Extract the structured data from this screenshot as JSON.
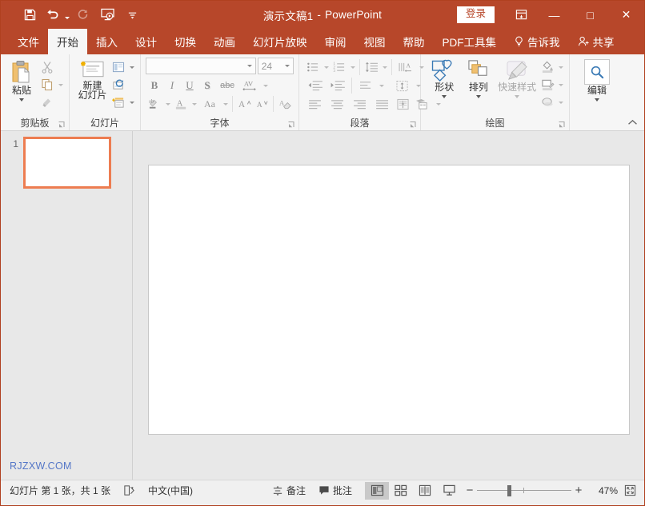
{
  "titlebar": {
    "quick_access": [
      {
        "name": "save-icon",
        "label": "保存"
      },
      {
        "name": "undo-icon",
        "label": "撤消"
      },
      {
        "name": "redo-icon",
        "label": "恢复"
      },
      {
        "name": "start-slideshow-icon",
        "label": "从头开始"
      },
      {
        "name": "customize-qat-icon",
        "label": "自定义快速访问工具栏"
      }
    ],
    "document_title": "演示文稿1",
    "separator": "-",
    "app_name": "PowerPoint",
    "signin_label": "登录",
    "ribbon_display_options": "ribbon-display-options-icon",
    "minimize": "—",
    "maximize": "□",
    "close": "✕",
    "accent_color": "#b7472a"
  },
  "tabs": [
    {
      "label": "文件",
      "active": false
    },
    {
      "label": "开始",
      "active": true
    },
    {
      "label": "插入",
      "active": false
    },
    {
      "label": "设计",
      "active": false
    },
    {
      "label": "切换",
      "active": false
    },
    {
      "label": "动画",
      "active": false
    },
    {
      "label": "幻灯片放映",
      "active": false
    },
    {
      "label": "审阅",
      "active": false
    },
    {
      "label": "视图",
      "active": false
    },
    {
      "label": "帮助",
      "active": false
    },
    {
      "label": "PDF工具集",
      "active": false
    },
    {
      "label": "告诉我",
      "active": false,
      "icon": "lightbulb-icon"
    },
    {
      "label": "共享",
      "active": false,
      "icon": "share-person-icon"
    }
  ],
  "ribbon": {
    "groups": [
      {
        "label": "剪贴板",
        "has_launcher": true,
        "paste_label": "粘贴",
        "items": [
          {
            "name": "cut-icon",
            "label": "剪切"
          },
          {
            "name": "copy-icon",
            "label": "复制"
          },
          {
            "name": "format-painter-icon",
            "label": "格式刷"
          }
        ]
      },
      {
        "label": "幻灯片",
        "has_launcher": false,
        "new_slide_label_line1": "新建",
        "new_slide_label_line2": "幻灯片",
        "items": [
          {
            "name": "layout-icon",
            "label": "版式"
          },
          {
            "name": "reset-icon",
            "label": "重置"
          },
          {
            "name": "section-icon",
            "label": "节"
          }
        ]
      },
      {
        "label": "字体",
        "has_launcher": true,
        "font_name_value": "",
        "font_size_value": "24",
        "items": [
          {
            "name": "bold-icon",
            "label": "B"
          },
          {
            "name": "italic-icon",
            "label": "I"
          },
          {
            "name": "underline-icon",
            "label": "U"
          },
          {
            "name": "shadow-icon",
            "label": "S"
          },
          {
            "name": "strikethrough-icon",
            "label": "abc"
          },
          {
            "name": "character-spacing-icon",
            "label": "AV"
          },
          {
            "name": "text-highlight-icon",
            "label": "ab"
          },
          {
            "name": "font-color-icon",
            "label": "A"
          },
          {
            "name": "change-case-icon",
            "label": "Aa"
          },
          {
            "name": "increase-font-size-icon",
            "label": "A"
          },
          {
            "name": "decrease-font-size-icon",
            "label": "A"
          },
          {
            "name": "clear-formatting-icon",
            "label": "清除所有格式"
          }
        ]
      },
      {
        "label": "段落",
        "has_launcher": true,
        "items": [
          {
            "name": "bullets-icon",
            "label": "项目符号"
          },
          {
            "name": "numbering-icon",
            "label": "编号"
          },
          {
            "name": "line-spacing-icon",
            "label": "行距"
          },
          {
            "name": "text-direction-icon",
            "label": "文字方向"
          },
          {
            "name": "decrease-indent-icon",
            "label": "减少缩进量"
          },
          {
            "name": "increase-indent-icon",
            "label": "增加缩进量"
          },
          {
            "name": "paragraph-direction-icon",
            "label": "文本对齐"
          },
          {
            "name": "align-text-icon",
            "label": "对齐文本"
          },
          {
            "name": "align-left-icon",
            "label": "左对齐"
          },
          {
            "name": "align-center-icon",
            "label": "居中"
          },
          {
            "name": "align-right-icon",
            "label": "右对齐"
          },
          {
            "name": "justify-icon",
            "label": "两端对齐"
          },
          {
            "name": "columns-icon",
            "label": "分栏"
          },
          {
            "name": "convert-smartart-icon",
            "label": "转换为 SmartArt"
          }
        ]
      },
      {
        "label": "绘图",
        "has_launcher": true,
        "shapes_label": "形状",
        "arrange_label": "排列",
        "quick_styles_label": "快速样式",
        "items": [
          {
            "name": "shape-fill-icon",
            "label": "形状填充"
          },
          {
            "name": "shape-outline-icon",
            "label": "形状轮廓"
          },
          {
            "name": "shape-effects-icon",
            "label": "形状效果"
          }
        ]
      },
      {
        "label": "编辑",
        "has_launcher": false,
        "editing_label": "编辑"
      }
    ],
    "collapse_icon": "collapse-ribbon-chevron-icon"
  },
  "slide_pane": {
    "thumbnails": [
      {
        "number": "1",
        "selected": true
      }
    ],
    "watermark": "RJZXW.COM",
    "selection_color": "#ed7d51"
  },
  "statusbar": {
    "slide_count_text": "幻灯片 第 1 张，共 1 张",
    "accessibility_icon": "accessibility-checker-icon",
    "language": "中文(中国)",
    "notes_label": "备注",
    "comments_label": "批注",
    "views": [
      {
        "name": "normal-view",
        "label": "普通视图",
        "active": true
      },
      {
        "name": "slide-sorter-view",
        "label": "幻灯片浏览",
        "active": false
      },
      {
        "name": "reading-view",
        "label": "阅读视图",
        "active": false
      },
      {
        "name": "slide-show-view",
        "label": "幻灯片放映",
        "active": false
      }
    ],
    "zoom_out": "−",
    "zoom_in": "+",
    "zoom_value": "47%",
    "fit_label": "使幻灯片适应当前窗口"
  }
}
